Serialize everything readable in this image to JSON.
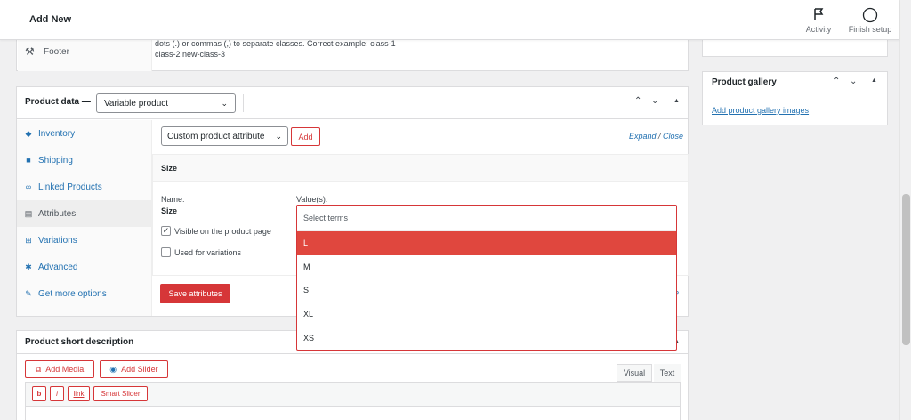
{
  "topbar": {
    "title": "Add New",
    "activity_label": "Activity",
    "finish_setup_label": "Finish setup"
  },
  "advanced_panel": {
    "footer_label": "Footer",
    "help_line1": "dots (.) or commas (,) to separate classes. Correct example: class-1",
    "help_line2": "class-2 new-class-3"
  },
  "product_data": {
    "title": "Product data —",
    "product_type": "Variable product",
    "tabs": [
      {
        "label": "Inventory",
        "icon": "inventory-icon",
        "glyph": "◆"
      },
      {
        "label": "Shipping",
        "icon": "truck-icon",
        "glyph": "■"
      },
      {
        "label": "Linked Products",
        "icon": "link-icon",
        "glyph": "∞"
      },
      {
        "label": "Attributes",
        "icon": "list-icon",
        "glyph": "▤"
      },
      {
        "label": "Variations",
        "icon": "grid-icon",
        "glyph": "⊞"
      },
      {
        "label": "Advanced",
        "icon": "gear-icon",
        "glyph": "✱"
      },
      {
        "label": "Get more options",
        "icon": "plugin-icon",
        "glyph": "✎"
      }
    ],
    "attribute_select": "Custom product attribute",
    "add_button": "Add",
    "expand_label": "Expand",
    "slash": " / ",
    "close_label": "Close",
    "attribute_header": "Size",
    "name_label": "Name:",
    "name_value": "Size",
    "values_label": "Value(s):",
    "visible_label": "Visible on the product page",
    "visible_checked": true,
    "variations_label": "Used for variations",
    "variations_checked": false,
    "save_button": "Save attributes",
    "hidden_link_fragment": "e"
  },
  "dropdown": {
    "placeholder": "Select terms",
    "options": [
      "L",
      "M",
      "S",
      "XL",
      "XS"
    ],
    "highlighted": "L"
  },
  "gallery": {
    "title": "Product gallery",
    "add_link": "Add product gallery images"
  },
  "short_description": {
    "title": "Product short description",
    "add_media": "Add Media",
    "add_slider": "Add Slider",
    "tab_visual": "Visual",
    "tab_text": "Text",
    "quicktags": [
      "b",
      "i",
      "link",
      "Smart Slider"
    ]
  },
  "colors": {
    "accent": "#d63638",
    "highlight": "#e0473e",
    "link": "#2271b1"
  }
}
